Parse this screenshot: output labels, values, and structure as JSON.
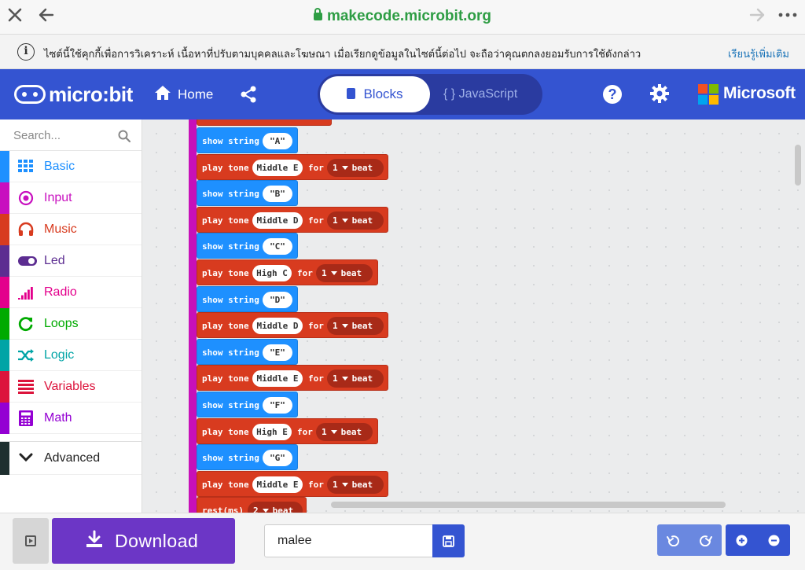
{
  "browser": {
    "url": "makecode.microbit.org",
    "close_icon": "close-icon",
    "back_icon": "back-arrow-icon",
    "forward_icon": "forward-arrow-icon",
    "more_icon": "more-icon"
  },
  "cookie_bar": {
    "text": "ไซต์นี้ใช้คุกกี้เพื่อการวิเคราะห์ เนื้อหาที่ปรับตามบุคคลและโฆษณา เมื่อเรียกดูข้อมูลในไซต์นี้ต่อไป จะถือว่าคุณตกลงยอมรับการใช้ดังกล่าว",
    "link": "เรียนรู้เพิ่มเติม"
  },
  "header": {
    "logo_text": "micro:bit",
    "home_label": "Home",
    "blocks_label": "Blocks",
    "javascript_label": "{ } JavaScript",
    "brand": "Microsoft",
    "colors": {
      "header_bg": "#3454d1",
      "toggle_bg": "#2a3ba0"
    }
  },
  "sidebar": {
    "search_placeholder": "Search...",
    "categories": [
      {
        "label": "Basic",
        "color": "#1e90ff",
        "icon": "grid-icon"
      },
      {
        "label": "Input",
        "color": "#c80fbf",
        "icon": "target-icon"
      },
      {
        "label": "Music",
        "color": "#d83b1f",
        "icon": "headphones-icon"
      },
      {
        "label": "Led",
        "color": "#5c2d91",
        "icon": "toggle-icon"
      },
      {
        "label": "Radio",
        "color": "#e3008c",
        "icon": "signal-icon"
      },
      {
        "label": "Loops",
        "color": "#00aa00",
        "icon": "refresh-icon"
      },
      {
        "label": "Logic",
        "color": "#00a4a6",
        "icon": "shuffle-icon"
      },
      {
        "label": "Variables",
        "color": "#dc143c",
        "icon": "list-icon"
      },
      {
        "label": "Math",
        "color": "#9400d3",
        "icon": "calculator-icon"
      }
    ],
    "advanced_label": "Advanced"
  },
  "workspace": {
    "show_string_label": "show string",
    "play_tone_label": "play tone",
    "for_label": "for",
    "beat_label": "beat",
    "rest_label": "rest(ms)",
    "blocks": [
      {
        "kind": "show",
        "value": "\"A\""
      },
      {
        "kind": "tone",
        "note": "Middle E",
        "beats": "1"
      },
      {
        "kind": "show",
        "value": "\"B\""
      },
      {
        "kind": "tone",
        "note": "Middle D",
        "beats": "1"
      },
      {
        "kind": "show",
        "value": "\"C\""
      },
      {
        "kind": "tone",
        "note": "High C",
        "beats": "1"
      },
      {
        "kind": "show",
        "value": "\"D\""
      },
      {
        "kind": "tone",
        "note": "Middle D",
        "beats": "1"
      },
      {
        "kind": "show",
        "value": "\"E\""
      },
      {
        "kind": "tone",
        "note": "Middle E",
        "beats": "1"
      },
      {
        "kind": "show",
        "value": "\"F\""
      },
      {
        "kind": "tone",
        "note": "High E",
        "beats": "1"
      },
      {
        "kind": "show",
        "value": "\"G\""
      },
      {
        "kind": "tone",
        "note": "Middle E",
        "beats": "1"
      },
      {
        "kind": "rest",
        "beats": "2"
      }
    ],
    "colors": {
      "show_string": "#1e90ff",
      "play_tone": "#d83b1f",
      "stack": "#c710b9"
    }
  },
  "footer": {
    "download_label": "Download",
    "project_name": "malee",
    "colors": {
      "download_bg": "#6c36c6"
    }
  }
}
